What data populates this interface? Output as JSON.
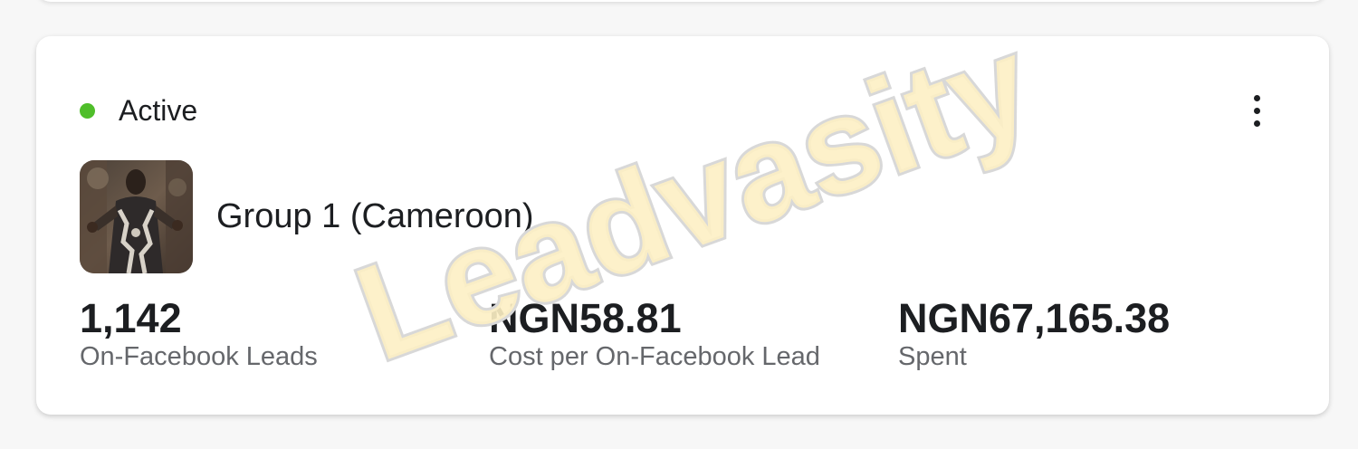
{
  "status": {
    "label": "Active",
    "color": "#4fbe2a"
  },
  "menu": {
    "icon": "more-vertical-icon"
  },
  "adgroup": {
    "name": "Group 1 (Cameroon)",
    "thumbnail_icon": "ad-creative-thumbnail"
  },
  "metrics": [
    {
      "value": "1,142",
      "label": "On-Facebook Leads"
    },
    {
      "value": "NGN58.81",
      "label": "Cost per On-Facebook Lead"
    },
    {
      "value": "NGN67,165.38",
      "label": "Spent"
    }
  ],
  "watermark": {
    "text": "Leadvasity",
    "color": "#fdf0c4"
  }
}
